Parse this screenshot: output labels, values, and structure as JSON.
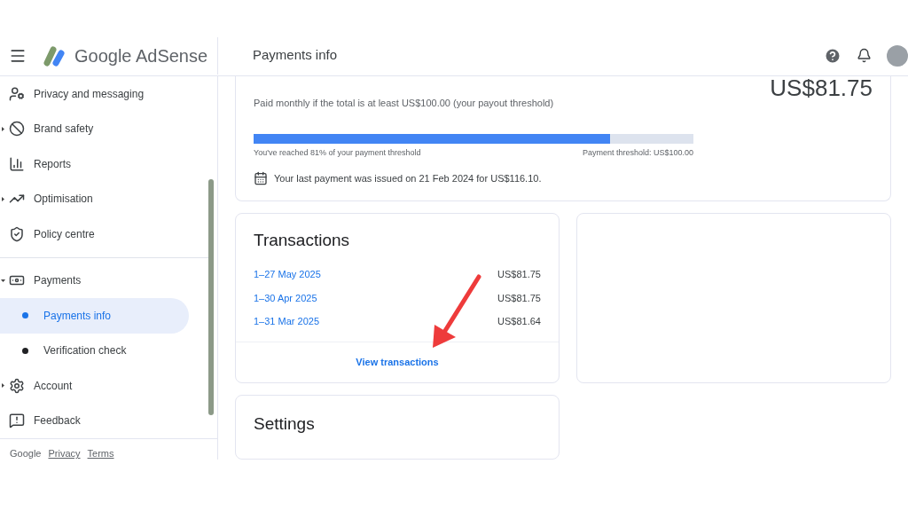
{
  "header": {
    "logo_text": "Google AdSense",
    "page_title": "Payments info"
  },
  "sidebar": {
    "sections": [
      [
        {
          "label": "Privacy and messaging",
          "selected": false
        },
        {
          "label": "Brand safety",
          "selected": false,
          "expanded": false
        },
        {
          "label": "Reports",
          "selected": false
        },
        {
          "label": "Optimisation",
          "selected": false,
          "expanded": false
        },
        {
          "label": "Policy centre",
          "selected": false
        }
      ],
      [
        {
          "label": "Payments",
          "selected": false,
          "expanded": true,
          "children": [
            {
              "label": "Payments info",
              "selected": true
            },
            {
              "label": "Verification check",
              "selected": false
            }
          ]
        },
        {
          "label": "Account",
          "selected": false,
          "expanded": false
        },
        {
          "label": "Feedback",
          "selected": false
        }
      ]
    ],
    "footer": {
      "brand": "Google",
      "links": [
        "Privacy",
        "Terms"
      ]
    }
  },
  "earnings": {
    "amount": "US$81.75",
    "note": "Paid monthly if the total is at least US$100.00 (your payout threshold)",
    "progress": {
      "level": 0.81,
      "left_caption": "You've reached 81% of your payment threshold",
      "right_caption": "Payment threshold: US$100.00"
    },
    "last_payment": "Your last payment was issued on 21 Feb 2024 for US$116.10."
  },
  "transactions": {
    "title": "Transactions",
    "rows": [
      {
        "period": "1–27 May 2025",
        "amount": "US$81.75"
      },
      {
        "period": "1–30 Apr 2025",
        "amount": "US$81.75"
      },
      {
        "period": "1–31 Mar 2025",
        "amount": "US$81.64"
      }
    ],
    "link": "View transactions"
  },
  "settings": {
    "title": "Settings"
  }
}
